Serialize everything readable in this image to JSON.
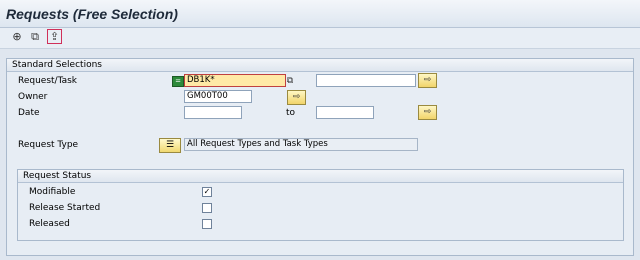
{
  "window": {
    "title": "Requests (Free Selection)"
  },
  "toolbar": {
    "icons": [
      "execute-icon",
      "variant-icon",
      "get-variant-icon"
    ]
  },
  "standard": {
    "title": "Standard Selections",
    "request_task_label": "Request/Task",
    "request_task_value": "DB1K*",
    "request_task_to_value": "",
    "owner_label": "Owner",
    "owner_value": "GM00T00",
    "date_label": "Date",
    "date_from": "",
    "date_to_label": "to",
    "date_to": "",
    "request_type_label": "Request Type",
    "request_type_value": "All Request Types and Task Types"
  },
  "status": {
    "title": "Request Status",
    "items": [
      {
        "label": "Modifiable",
        "checked": true
      },
      {
        "label": "Release Started",
        "checked": false
      },
      {
        "label": "Released",
        "checked": false
      }
    ]
  }
}
